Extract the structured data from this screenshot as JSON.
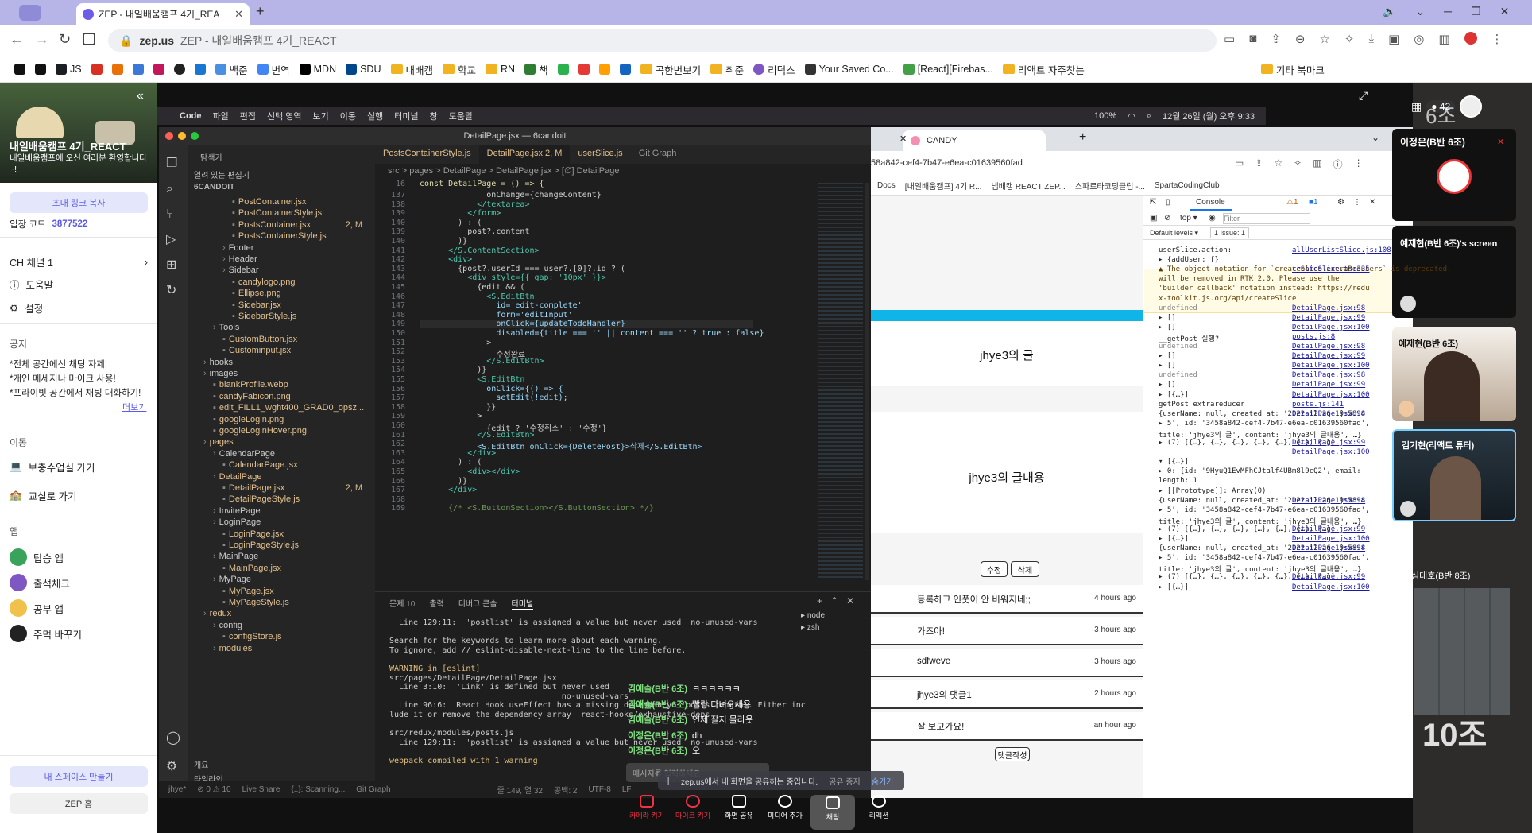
{
  "browser": {
    "tab_title": "ZEP - 내일배움캠프 4기_REA",
    "url_host": "zep.us",
    "url_text": "ZEP - 내일배움캠프 4기_REACT",
    "bookmarks": [
      "JS",
      "백준",
      "번역",
      "MDN",
      "SDU",
      "내배캠",
      "학교",
      "RN",
      "책",
      "곡한번보기",
      "취준",
      "리덕스",
      "Your Saved Co...",
      "[React][Firebas...",
      "리액트 자주찾는",
      "기타 북마크"
    ]
  },
  "zep": {
    "space_title": "내일배움캠프 4기_REACT",
    "space_subtitle": "내일배움캠프에 오신 여러분 환영합니다~!",
    "invite_button": "초대 링크 복사",
    "entry_code_label": "입장 코드",
    "entry_code": "3877522",
    "channel": "CH  채널 1",
    "help": "도움말",
    "settings": "설정",
    "notice_heading": "공지",
    "notices": [
      "*전체 공간에선 채팅 자제!",
      "*개인 메세지나 마이크 사용!",
      "*프라이빗 공간에서 채팅 대화하기!"
    ],
    "more": "더보기",
    "move_heading": "이동",
    "move_items": [
      "보충수업실 가기",
      "교실로 가기"
    ],
    "apps_heading": "앱",
    "apps": [
      "탑승 앱",
      "출석체크",
      "공부 앱",
      "주먹 바꾸기"
    ],
    "make_space": "내 스페이스 만들기",
    "zep_home": "ZEP 홈"
  },
  "macmenu": [
    "Code",
    "파일",
    "편집",
    "선택 영역",
    "보기",
    "이동",
    "실행",
    "터미널",
    "창",
    "도움말"
  ],
  "macstatus": {
    "battery": "100%",
    "datetime": "12월 26일 (월) 오후 9:33"
  },
  "vscode": {
    "title": "DetailPage.jsx — 6candoit",
    "explorer_label": "탐색기",
    "open_editors": "열려 있는 편집기",
    "project": "6CANDOIT",
    "tree": [
      {
        "name": "PostContainer.jsx",
        "indent": 3,
        "color": "y"
      },
      {
        "name": "PostContainerStyle.js",
        "indent": 3,
        "color": "y"
      },
      {
        "name": "PostsContainer.jsx",
        "indent": 3,
        "color": "y",
        "badge": "2, M"
      },
      {
        "name": "PostsContainerStyle.js",
        "indent": 3,
        "color": "y"
      },
      {
        "name": "Footer",
        "indent": 2,
        "color": "dir"
      },
      {
        "name": "Header",
        "indent": 2,
        "color": "dir"
      },
      {
        "name": "Sidebar",
        "indent": 2,
        "color": "dir"
      },
      {
        "name": "candylogo.png",
        "indent": 3,
        "color": "y"
      },
      {
        "name": "Ellipse.png",
        "indent": 3,
        "color": "y"
      },
      {
        "name": "Sidebar.jsx",
        "indent": 3,
        "color": "y"
      },
      {
        "name": "SidebarStyle.js",
        "indent": 3,
        "color": "y"
      },
      {
        "name": "Tools",
        "indent": 1,
        "color": "dir"
      },
      {
        "name": "CustomButton.jsx",
        "indent": 2,
        "color": "y"
      },
      {
        "name": "Custominput.jsx",
        "indent": 2,
        "color": "y"
      },
      {
        "name": "hooks",
        "indent": 0,
        "color": "dir"
      },
      {
        "name": "images",
        "indent": 0,
        "color": "dir"
      },
      {
        "name": "blankProfile.webp",
        "indent": 1,
        "color": "y"
      },
      {
        "name": "candyFabicon.png",
        "indent": 1,
        "color": "y"
      },
      {
        "name": "edit_FILL1_wght400_GRAD0_opsz...",
        "indent": 1,
        "color": "y"
      },
      {
        "name": "googleLogin.png",
        "indent": 1,
        "color": "y"
      },
      {
        "name": "googleLoginHover.png",
        "indent": 1,
        "color": "y"
      },
      {
        "name": "pages",
        "indent": 0,
        "color": "y"
      },
      {
        "name": "CalendarPage",
        "indent": 1,
        "color": "dir"
      },
      {
        "name": "CalendarPage.jsx",
        "indent": 2,
        "color": "y"
      },
      {
        "name": "DetailPage",
        "indent": 1,
        "color": "y"
      },
      {
        "name": "DetailPage.jsx",
        "indent": 2,
        "color": "y",
        "badge": "2, M"
      },
      {
        "name": "DetailPageStyle.js",
        "indent": 2,
        "color": "y"
      },
      {
        "name": "InvitePage",
        "indent": 1,
        "color": "dir"
      },
      {
        "name": "LoginPage",
        "indent": 1,
        "color": "dir"
      },
      {
        "name": "LoginPage.jsx",
        "indent": 2,
        "color": "y"
      },
      {
        "name": "LoginPageStyle.js",
        "indent": 2,
        "color": "y"
      },
      {
        "name": "MainPage",
        "indent": 1,
        "color": "dir"
      },
      {
        "name": "MainPage.jsx",
        "indent": 2,
        "color": "y"
      },
      {
        "name": "MyPage",
        "indent": 1,
        "color": "dir"
      },
      {
        "name": "MyPage.jsx",
        "indent": 2,
        "color": "y"
      },
      {
        "name": "MyPageStyle.js",
        "indent": 2,
        "color": "y"
      },
      {
        "name": "redux",
        "indent": 0,
        "color": "y"
      },
      {
        "name": "config",
        "indent": 1,
        "color": "dir"
      },
      {
        "name": "configStore.js",
        "indent": 2,
        "color": "y"
      },
      {
        "name": "modules",
        "indent": 1,
        "color": "y"
      }
    ],
    "outline": "개요",
    "timeline": "타임라인",
    "tabs": [
      "PostsContainerStyle.js",
      "DetailPage.jsx 2, M",
      "userSlice.js",
      "Git Graph"
    ],
    "breadcrumb": "src > pages > DetailPage > DetailPage.jsx > [∅] DetailPage",
    "sticky_line": {
      "num": "16",
      "code": "const DetailPage = () => {"
    },
    "lines": [
      {
        "num": "137",
        "code": "              onChange={changeContent}"
      },
      {
        "num": "138",
        "code": "            </textarea>"
      },
      {
        "num": "139",
        "code": "          </form>"
      },
      {
        "num": "140",
        "code": "        ) : ("
      },
      {
        "num": "139",
        "code": "          post?.content"
      },
      {
        "num": "140",
        "code": "        )}"
      },
      {
        "num": "141",
        "code": "      </S.ContentSection>"
      },
      {
        "num": "142",
        "code": "      <div>"
      },
      {
        "num": "143",
        "code": "        {post?.userId === user?.[0]?.id ? ("
      },
      {
        "num": "144",
        "code": "          <div style={{ gap: '10px' }}>"
      },
      {
        "num": "145",
        "code": "            {edit && ("
      },
      {
        "num": "146",
        "code": "              <S.EditBtn"
      },
      {
        "num": "147",
        "code": "                id='edit-complete'"
      },
      {
        "num": "148",
        "code": "                form='editInput'"
      },
      {
        "num": "149",
        "code": "                onClick={updateTodoHandler}"
      },
      {
        "num": "150",
        "code": "                disabled={title === '' || content === '' ? true : false}"
      },
      {
        "num": "151",
        "code": "              >"
      },
      {
        "num": "152",
        "code": "                수정완료"
      },
      {
        "num": "153",
        "code": "              </S.EditBtn>"
      },
      {
        "num": "154",
        "code": "            )}"
      },
      {
        "num": "155",
        "code": "            <S.EditBtn"
      },
      {
        "num": "156",
        "code": "              onClick={() => {"
      },
      {
        "num": "157",
        "code": "                setEdit(!edit);"
      },
      {
        "num": "158",
        "code": "              }}"
      },
      {
        "num": "159",
        "code": "            >"
      },
      {
        "num": "160",
        "code": "              {edit ? '수정취소' : '수정'}"
      },
      {
        "num": "161",
        "code": "            </S.EditBtn>"
      },
      {
        "num": "162",
        "code": "            <S.EditBtn onClick={DeletePost}>삭제</S.EditBtn>"
      },
      {
        "num": "163",
        "code": "          </div>"
      },
      {
        "num": "164",
        "code": "        ) : ("
      },
      {
        "num": "165",
        "code": "          <div></div>"
      },
      {
        "num": "166",
        "code": "        )}"
      },
      {
        "num": "167",
        "code": "      </div>"
      },
      {
        "num": "168",
        "code": ""
      },
      {
        "num": "169",
        "code": "      {/* <S.ButtonSection></S.ButtonSection> */}"
      }
    ],
    "panel_tabs": [
      "문제",
      "출력",
      "디버그 콘솔",
      "터미널"
    ],
    "panel_problems_count": "10",
    "terminal_lines": [
      "  Line 129:11:  'postlist' is assigned a value but never used  no-unused-vars",
      "",
      "Search for the keywords to learn more about each warning.",
      "To ignore, add // eslint-disable-next-line to the line before.",
      "",
      "WARNING in [eslint]",
      "src/pages/DetailPage/DetailPage.jsx",
      "  Line 3:10:  'Link' is defined but never used",
      "                                    no-unused-vars",
      "  Line 96:6:  React Hook useEffect has a missing dependency: 'posts.length'. Either inc",
      "lude it or remove the dependency array  react-hooks/exhaustive-deps",
      "",
      "src/redux/modules/posts.js",
      "  Line 129:11:  'postlist' is assigned a value but never used  no-unused-vars",
      "",
      "webpack compiled with 1 warning"
    ],
    "terminals": [
      "node",
      "zsh"
    ],
    "status": [
      "jhye*",
      "⊘ 0 ⚠ 10",
      "Live Share",
      "{..}: Scanning...",
      "Git Graph",
      "줄 149, 열 32",
      "공백: 2",
      "UTF-8",
      "LF"
    ]
  },
  "app": {
    "tab_title": "CANDY",
    "url": "58a842-cef4-7b47-e6ea-c01639560fad",
    "bookmarks": [
      "Docs",
      "[내일배움캠프] 4기 R...",
      "냅배캠 REACT ZEP...",
      "스파르타코딩클럽 -...",
      "SpartaCodingClub"
    ],
    "post_title": "jhye3의 글",
    "post_content": "jhye3의 글내용",
    "edit_button": "수정",
    "delete_button": "삭제",
    "comments": [
      {
        "text": "등록하고 인풋이 안 비워지네;;",
        "time": "4 hours ago"
      },
      {
        "text": "가즈아!",
        "time": "3 hours ago"
      },
      {
        "text": "sdfweve",
        "time": "3 hours ago"
      },
      {
        "text": "jhye3의 댓글1",
        "time": "2 hours ago"
      },
      {
        "text": "잘 보고가요!",
        "time": "an hour ago"
      }
    ],
    "comment_button": "댓글작성"
  },
  "devtools": {
    "tabs": [
      "Console"
    ],
    "warn_count": "1",
    "info_count": "1",
    "context": "top",
    "filter_placeholder": "Filter",
    "levels": "Default levels",
    "issues": "1 Issue: 1",
    "lines": [
      {
        "l": "userSlice.action:",
        "r": "allUserListSlice.js:108"
      },
      {
        "l": "▸ {addUser: f}",
        "r": ""
      },
      {
        "l": "▲ The object notation for `createSlice.extraReducers` is deprecated,",
        "r": "createSlice.ts:335"
      },
      {
        "l": "  will be removed in RTK 2.0. Please use the",
        "r": ""
      },
      {
        "l": "  'builder callback' notation instead: https://redu",
        "r": ""
      },
      {
        "l": "  x-toolkit.js.org/api/createSlice",
        "r": ""
      },
      {
        "l": "undefined",
        "r": "DetailPage.jsx:98"
      },
      {
        "l": "▸ []",
        "r": "DetailPage.jsx:99"
      },
      {
        "l": "▸ []",
        "r": "DetailPage.jsx:100"
      },
      {
        "l": "__getPost 실행?",
        "r": "posts.js:8"
      },
      {
        "l": "undefined",
        "r": "DetailPage.jsx:98"
      },
      {
        "l": "▸ []",
        "r": "DetailPage.jsx:99"
      },
      {
        "l": "▸ []",
        "r": "DetailPage.jsx:100"
      },
      {
        "l": "undefined",
        "r": "DetailPage.jsx:98"
      },
      {
        "l": "▸ []",
        "r": "DetailPage.jsx:99"
      },
      {
        "l": "▸ [{…}]",
        "r": "DetailPage.jsx:100"
      },
      {
        "l": "getPost extrareducer",
        "r": "posts.js:141"
      },
      {
        "l": "  {userName: null, created_at: '2022.12.26 19:58:4",
        "r": "DetailPage.jsx:98"
      },
      {
        "l": "▸ 5', id: '3458a842-cef4-7b47-e6ea-c01639560fad',",
        "r": ""
      },
      {
        "l": "  title: 'jhye3의 글', content: 'jhye3의 글내용', …}",
        "r": ""
      },
      {
        "l": "▸ (7) [{…}, {…}, {…}, {…}, {…}, {…}, {…}]",
        "r": "DetailPage.jsx:99"
      },
      {
        "l": "",
        "r": "DetailPage.jsx:100"
      },
      {
        "l": "▾ [{…}]",
        "r": ""
      },
      {
        "l": "  ▸ 0: {id: '9HyuQ1EvMFhCJtalf4UBm8l9cQ2', email:",
        "r": ""
      },
      {
        "l": "    length: 1",
        "r": ""
      },
      {
        "l": "  ▸ [[Prototype]]: Array(0)",
        "r": ""
      },
      {
        "l": "  {userName: null, created_at: '2022.12.26 19:58:4",
        "r": "DetailPage.jsx:98"
      },
      {
        "l": "▸ 5', id: '3458a842-cef4-7b47-e6ea-c01639560fad',",
        "r": ""
      },
      {
        "l": "  title: 'jhye3의 글', content: 'jhye3의 글내용', …}",
        "r": ""
      },
      {
        "l": "▸ (7) [{…}, {…}, {…}, {…}, {…}, {…}, {…}]",
        "r": "DetailPage.jsx:99"
      },
      {
        "l": "▸ [{…}]",
        "r": "DetailPage.jsx:100"
      },
      {
        "l": "  {userName: null, created_at: '2022.12.26 19:58:4",
        "r": "DetailPage.jsx:98"
      },
      {
        "l": "▸ 5', id: '3458a842-cef4-7b47-e6ea-c01639560fad',",
        "r": ""
      },
      {
        "l": "  title: 'jhye3의 글', content: 'jhye3의 글내용', …}",
        "r": ""
      },
      {
        "l": "▸ (7) [{…}, {…}, {…}, {…}, {…}, {…}, {…}]",
        "r": "DetailPage.jsx:99"
      },
      {
        "l": "▸ [{…}]",
        "r": "DetailPage.jsx:100"
      }
    ]
  },
  "chat": [
    {
      "name": "김예솔(B반 6조)",
      "msg": "ㅋㅋㅋㅋㅋㅋ"
    },
    {
      "name": "김예솔(B반 6조)",
      "msg": "빨랑 다녀오세용"
    },
    {
      "name": "김예솔(B반 6조)",
      "msg": "언제 잘지 몰라욧"
    },
    {
      "name": "이정은(B반 6조)",
      "msg": "dh"
    },
    {
      "name": "이정은(B반 6조)",
      "msg": "오"
    }
  ],
  "chat_input_placeholder": "메시지를 입력하세요",
  "share_notice": "zep.us에서 내 화면을 공유하는 중입니다.",
  "share_stop": "공유 중지",
  "share_hide": "숨기기",
  "bottom_bar": [
    "카메라 켜기",
    "마이크 켜기",
    "화면 공유",
    "미디어 추가",
    "채팅",
    "리액션"
  ],
  "participants": {
    "count": "42",
    "group_label": "6조",
    "people": [
      "이정은(B반 6조)",
      "예재현(B반 6조)'s screen",
      "예재현(B반 6조)",
      "김기현(리액트 튜터)",
      "심대호(B반 8조)"
    ],
    "room_label": "10조"
  }
}
